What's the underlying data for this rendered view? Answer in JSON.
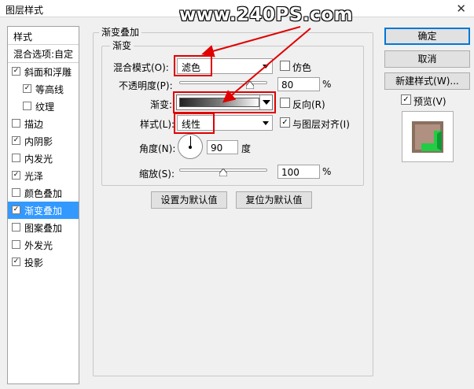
{
  "window": {
    "title": "图层样式",
    "close_glyph": "✕"
  },
  "watermark": "www.240PS.com",
  "left_panel": {
    "header": "样式",
    "blend_options": "混合选项:自定",
    "items": [
      {
        "label": "斜面和浮雕",
        "checked": true,
        "indent": false,
        "selected": false
      },
      {
        "label": "等高线",
        "checked": true,
        "indent": true,
        "selected": false
      },
      {
        "label": "纹理",
        "checked": false,
        "indent": true,
        "selected": false
      },
      {
        "label": "描边",
        "checked": false,
        "indent": false,
        "selected": false
      },
      {
        "label": "内阴影",
        "checked": true,
        "indent": false,
        "selected": false
      },
      {
        "label": "内发光",
        "checked": false,
        "indent": false,
        "selected": false
      },
      {
        "label": "光泽",
        "checked": true,
        "indent": false,
        "selected": false
      },
      {
        "label": "颜色叠加",
        "checked": false,
        "indent": false,
        "selected": false
      },
      {
        "label": "渐变叠加",
        "checked": true,
        "indent": false,
        "selected": true
      },
      {
        "label": "图案叠加",
        "checked": false,
        "indent": false,
        "selected": false
      },
      {
        "label": "外发光",
        "checked": false,
        "indent": false,
        "selected": false
      },
      {
        "label": "投影",
        "checked": true,
        "indent": false,
        "selected": false
      }
    ]
  },
  "main": {
    "group_title": "渐变叠加",
    "sub_group_title": "渐变",
    "blend_mode": {
      "label": "混合模式(O):",
      "value": "滤色"
    },
    "dither": {
      "label": "仿色",
      "checked": false
    },
    "opacity": {
      "label": "不透明度(P):",
      "value": "80",
      "unit": "%",
      "level": 0.8
    },
    "gradient": {
      "label": "渐变:"
    },
    "reverse": {
      "label": "反向(R)",
      "checked": false
    },
    "style": {
      "label": "样式(L):",
      "value": "线性"
    },
    "align_with_layer": {
      "label": "与图层对齐(I)",
      "checked": true
    },
    "angle": {
      "label": "角度(N):",
      "value": "90",
      "unit": "度"
    },
    "scale": {
      "label": "缩放(S):",
      "value": "100",
      "unit": "%",
      "level": 0.5
    },
    "set_default_btn": "设置为默认值",
    "reset_default_btn": "复位为默认值"
  },
  "right": {
    "ok": "确定",
    "cancel": "取消",
    "new_style": "新建样式(W)...",
    "preview": {
      "label": "预览(V)",
      "checked": true
    }
  },
  "colors": {
    "annotation_red": "#e00000",
    "selection_blue": "#3399ff",
    "preview_green": "#22cc44"
  }
}
